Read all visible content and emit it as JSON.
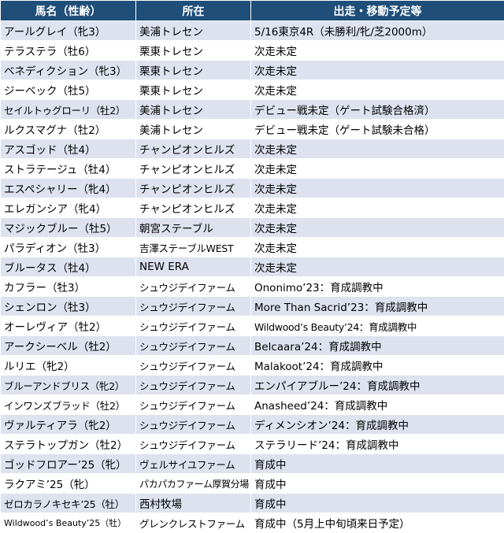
{
  "headers": {
    "horse": "馬名（性齢）",
    "location": "所在",
    "plan": "出走・移動予定等"
  },
  "rows": [
    {
      "horse": "アールグレイ（牝3）",
      "location": "美浦トレセン",
      "plan": "5/16東京4R（未勝利/牝/芝2000m）"
    },
    {
      "horse": "テラステラ（牡6）",
      "location": "栗東トレセン",
      "plan": "次走未定"
    },
    {
      "horse": "ベネディクション（牝3）",
      "location": "栗東トレセン",
      "plan": "次走未定"
    },
    {
      "horse": "ジーベック（牡5）",
      "location": "栗東トレセン",
      "plan": "次走未定"
    },
    {
      "horse": "セイルトゥグローリ（牡2）",
      "location": "美浦トレセン",
      "plan": "デビュー戦未定（ゲート試験合格済）"
    },
    {
      "horse": "ルクスマグナ（牡2）",
      "location": "美浦トレセン",
      "plan": "デビュー戦未定（ゲート試験未合格）"
    },
    {
      "horse": "アスゴッド（牡4）",
      "location": "チャンピオンヒルズ",
      "plan": "次走未定"
    },
    {
      "horse": "ストラテージュ（牡4）",
      "location": "チャンピオンヒルズ",
      "plan": "次走未定"
    },
    {
      "horse": "エスペシャリー（牝4）",
      "location": "チャンピオンヒルズ",
      "plan": "次走未定"
    },
    {
      "horse": "エレガンシア（牝4）",
      "location": "チャンピオンヒルズ",
      "plan": "次走未定"
    },
    {
      "horse": "マジックブルー（牡5）",
      "location": "朝宮ステーブル",
      "plan": "次走未定"
    },
    {
      "horse": "パラディオン（牡3）",
      "location": "吉澤ステーブルWEST",
      "plan": "次走未定"
    },
    {
      "horse": "ブルータス（牡4）",
      "location": "NEW ERA",
      "plan": "次走未定"
    },
    {
      "horse": "カフラー（牡3）",
      "location": "シュウジデイファーム",
      "plan": "Ononimo’23：育成調教中"
    },
    {
      "horse": "シェンロン（牡3）",
      "location": "シュウジデイファーム",
      "plan": "More Than Sacrid’23：育成調教中"
    },
    {
      "horse": "オーレヴィア（牡2）",
      "location": "シュウジデイファーム",
      "plan": "Wildwood’s Beauty’24：育成調教中"
    },
    {
      "horse": "アークシーベル（牡2）",
      "location": "シュウジデイファーム",
      "plan": "Belcaara’24：育成調教中"
    },
    {
      "horse": "ルリエ（牝2）",
      "location": "シュウジデイファーム",
      "plan": "Malakoot’24：育成調教中"
    },
    {
      "horse": "ブルーアンドブリス（牝2）",
      "location": "シュウジデイファーム",
      "plan": "エンパイアブルー’24：育成調教中"
    },
    {
      "horse": "インワンズブラッド（牡2）",
      "location": "シュウジデイファーム",
      "plan": "Anasheed’24：育成調教中"
    },
    {
      "horse": "ヴァルティアラ（牝2）",
      "location": "シュウジデイファーム",
      "plan": "ディメンシオン’24：育成調教中"
    },
    {
      "horse": "ステラトップガン（牡2）",
      "location": "シュウジデイファーム",
      "plan": "ステラリード’24：育成調教中"
    },
    {
      "horse": "ゴッドフロアー’25（牝）",
      "location": "ヴェルサイユファーム",
      "plan": "育成中"
    },
    {
      "horse": "ラクアミ’25（牝）",
      "location": "パカパカファーム厚賀分場",
      "plan": "育成中"
    },
    {
      "horse": "ゼロカラノキセキ’25（牡）",
      "location": "西村牧場",
      "plan": "育成中"
    },
    {
      "horse": "Wildwood’s Beauty’25（牡）",
      "location": "グレンクレストファーム",
      "plan": "育成中（5月上中旬頃来日予定）"
    }
  ]
}
